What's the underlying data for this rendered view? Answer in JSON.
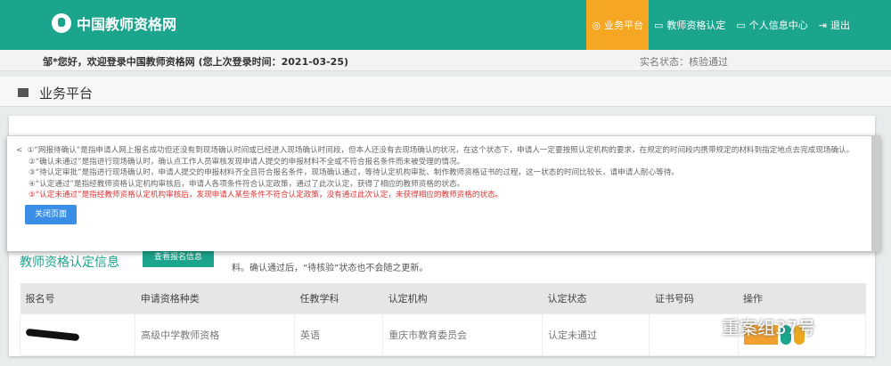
{
  "header": {
    "site_name": "中国教师资格网",
    "nav": [
      {
        "label": "业务平台",
        "active": true
      },
      {
        "label": "教师资格认定"
      },
      {
        "label": "个人信息中心"
      },
      {
        "label": "退出"
      }
    ]
  },
  "welcome": {
    "text": "邹*您好，欢迎登录中国教师资格网 (您上次登录时间：2021-03-25)",
    "status": "实名状态：核验通过"
  },
  "page_title": "业务平台",
  "section": {
    "title": "教师资格认定信息",
    "button": "查看报名信息",
    "note": "料。确认通过后，“待核验”状态也不会随之更新。"
  },
  "table": {
    "headers": [
      "报名号",
      "申请资格种类",
      "任教学科",
      "认定机构",
      "认定状态",
      "证书号码",
      "操作"
    ],
    "rows": [
      {
        "type": "高级中学教师资格",
        "subject": "英语",
        "agency": "重庆市教育委员会",
        "status": "认定未通过"
      }
    ]
  },
  "modal": {
    "back": "<",
    "lines": [
      "①“网报待确认”是指申请人网上报名成功但还没有到现场确认时间或已经进入现场确认时间段，但本人还没有去现场确认的状况，在这个状态下，申请人一定要按照认定机构的要求，在规定的时间段内携带规定的材料到指定地点去完成现场确认。",
      "②“确认未通过”是指进行现场确认时，确认点工作人员审核发现申请人提交的申报材料不全或不符合报名条件而未被受理的情况。",
      "③“待认定审批”是指进行现场确认时，申请人提交的申报材料齐全且符合报名条件，现场确认通过，等待认定机构审批、制作教师资格证书的过程，这一状态的时间比较长，请申请人耐心等待。",
      "④“认定通过”是指经教师资格认定机构审核后，申请人各项条件符合认定政策，通过了此次认定，获得了相应的教师资格的状态。",
      "⑤“认定未通过”是指经教师资格认定机构审核后，发现申请人某些条件不符合认定政策，没有通过此次认定，未获得相应的教师资格的状态。"
    ],
    "close": "关闭页面"
  },
  "watermark": "重案组37号"
}
